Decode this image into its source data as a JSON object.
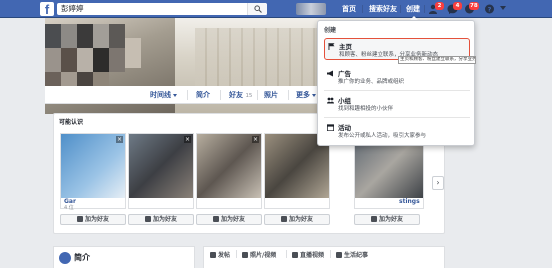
{
  "topbar": {
    "logo": "f",
    "search_value": "彭婷婷",
    "nav": {
      "home": "首页",
      "find_friends": "搜索好友",
      "create": "创建"
    },
    "badges": {
      "friends": "2",
      "messages": "4",
      "notifications": "78"
    }
  },
  "profile": {
    "tabs": {
      "timeline": "时间线",
      "about": "简介",
      "friends": "好友",
      "friends_count": "15",
      "photos": "照片",
      "more": "更多"
    }
  },
  "pymk": {
    "title": "可能认识",
    "cards": [
      {
        "name": "Gar",
        "sub": "4 位"
      },
      {
        "name": "",
        "sub": ""
      },
      {
        "name": "",
        "sub": ""
      },
      {
        "name": "",
        "sub": ""
      },
      {
        "name": "stings",
        "sub": ""
      }
    ],
    "add_label": "加为好友"
  },
  "intro": {
    "title": "简介"
  },
  "composer": {
    "post": "发帖",
    "photo": "照片/视频",
    "live": "直播视频",
    "life_event": "生活纪事"
  },
  "create_menu": {
    "header": "创建",
    "items": [
      {
        "title": "主页",
        "desc": "和顾客、粉丝建立联系，分享业务新动态"
      },
      {
        "title": "广告",
        "desc": "推广你的业务、品牌或组织"
      },
      {
        "title": "小组",
        "desc": "找到和趣相投的小伙伴"
      },
      {
        "title": "活动",
        "desc": "发布公开或私人活动，吸引大家参与"
      }
    ],
    "tooltip": "主页和顾客、粉丝建立联系，分享业务新动态"
  },
  "colors": {
    "facebook_blue": "#4267b2",
    "highlight_red": "#e4513b",
    "link_blue": "#365899",
    "badge_red": "#fa3e3e"
  }
}
